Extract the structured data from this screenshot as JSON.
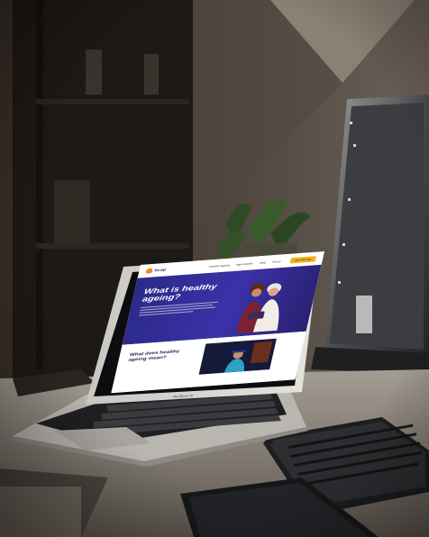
{
  "website": {
    "logo_text": "bcap",
    "nav_items": [
      "Healthy ageing",
      "Age-friendly",
      "Help",
      "About"
    ],
    "cta_label": "Get the app",
    "hero_title": "What is healthy ageing?",
    "section_title": "What does healthy ageing mean?"
  },
  "laptop": {
    "brand_label": "MacBook Air"
  },
  "colors": {
    "brand_navy": "#2b2a88",
    "accent_orange": "#f6b21b",
    "wall": "#5d5449",
    "desk": "#8c857c"
  }
}
